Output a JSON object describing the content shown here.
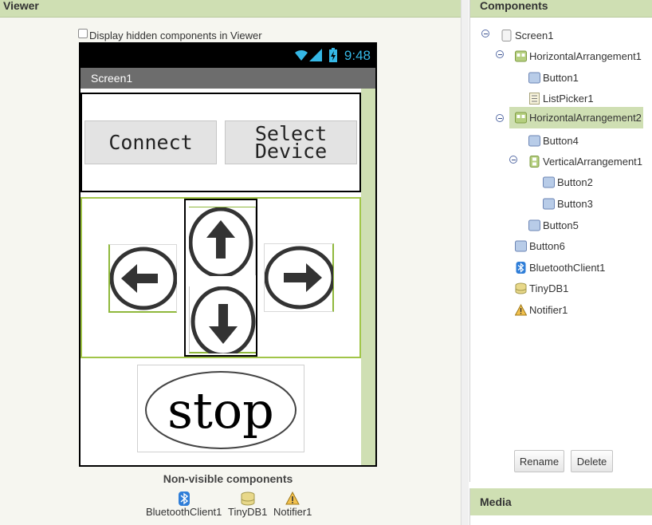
{
  "viewer": {
    "title": "Viewer",
    "hidden_checkbox_label": "Display hidden components in Viewer",
    "phone": {
      "time": "9:48",
      "screen_title": "Screen1",
      "connect_label": "Connect",
      "select_label": "Select\nDevice",
      "left_icon": "left-arrow-circle-icon",
      "up_icon": "up-arrow-circle-icon",
      "down_icon": "down-arrow-circle-icon",
      "right_icon": "right-arrow-circle-icon",
      "stop_text": "stop"
    },
    "nonvisible": {
      "title": "Non-visible components",
      "items": [
        {
          "label": "BluetoothClient1",
          "icon": "bluetooth-icon"
        },
        {
          "label": "TinyDB1",
          "icon": "database-icon"
        },
        {
          "label": "Notifier1",
          "icon": "warning-icon"
        }
      ]
    }
  },
  "components": {
    "title": "Components",
    "tree": [
      {
        "label": "Screen1",
        "icon": "screen-icon"
      },
      {
        "label": "HorizontalArrangement1",
        "icon": "horizontal-arrangement-icon"
      },
      {
        "label": "Button1",
        "icon": "button-icon"
      },
      {
        "label": "ListPicker1",
        "icon": "listpicker-icon"
      },
      {
        "label": "HorizontalArrangement2",
        "icon": "horizontal-arrangement-icon",
        "selected": true
      },
      {
        "label": "Button4",
        "icon": "button-icon"
      },
      {
        "label": "VerticalArrangement1",
        "icon": "vertical-arrangement-icon"
      },
      {
        "label": "Button2",
        "icon": "button-icon"
      },
      {
        "label": "Button3",
        "icon": "button-icon"
      },
      {
        "label": "Button5",
        "icon": "button-icon"
      },
      {
        "label": "Button6",
        "icon": "button-icon"
      },
      {
        "label": "BluetoothClient1",
        "icon": "bluetooth-icon"
      },
      {
        "label": "TinyDB1",
        "icon": "database-icon"
      },
      {
        "label": "Notifier1",
        "icon": "warning-icon"
      }
    ],
    "rename_label": "Rename",
    "delete_label": "Delete"
  },
  "media": {
    "title": "Media"
  },
  "colors": {
    "header_green": "#cfdfb3",
    "selection_green": "#a1c548",
    "status_blue": "#35b7e5"
  }
}
